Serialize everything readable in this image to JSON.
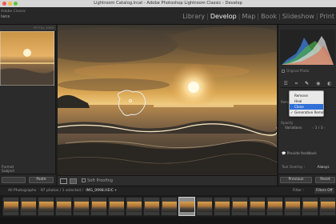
{
  "window": {
    "title": "Lightroom Catalog.lrcat - Adobe Photoshop Lightroom Classic - Develop"
  },
  "identity": {
    "line1": "Adobe Classic",
    "line2": "Ians"
  },
  "modules": [
    {
      "label": "Library",
      "active": false
    },
    {
      "label": "Develop",
      "active": true
    },
    {
      "label": "Map",
      "active": false
    },
    {
      "label": "Book",
      "active": false
    },
    {
      "label": "Slideshow",
      "active": false
    },
    {
      "label": "Print",
      "active": false
    }
  ],
  "left_panel": {
    "navigator_zoom": "FIT  FILL  100%",
    "preset_items": [
      "Format",
      "Subject",
      "Landscape",
      "Blur Background"
    ],
    "paste_label": "Paste"
  },
  "toolbar": {
    "soft_proofing": "Soft Proofing"
  },
  "right_panel": {
    "histogram_label": "Histogram",
    "original_photo": "Original Photo",
    "remove_label": "Remove",
    "opacity_label": "Opacity",
    "variations_label": "Variations",
    "variations_value": "1 / 3",
    "provide_feedback": "Provide feedback",
    "tool_overlay_label": "Tool Overlay :",
    "tool_overlay_value": "Always",
    "previous_label": "Previous",
    "reset_label": "Reset"
  },
  "dropdown": {
    "items": [
      {
        "label": "Remove",
        "checked": false,
        "selected": false
      },
      {
        "label": "Heal",
        "checked": false,
        "selected": false
      },
      {
        "label": "Clone",
        "checked": false,
        "selected": true
      },
      {
        "label": "Generative Remove",
        "checked": true,
        "selected": false
      }
    ]
  },
  "filmstrip": {
    "source": "All Photographs",
    "count": "97 photos / 1 selected /",
    "filename": "IMG_0998.HEIC",
    "filter_label": "Filter :",
    "filter_value": "Filters Off",
    "selected_index": 10,
    "thumb_count": 19
  },
  "colors": {
    "selection_blue": "#2f6fd8",
    "active_module": "#f0f0f0"
  }
}
